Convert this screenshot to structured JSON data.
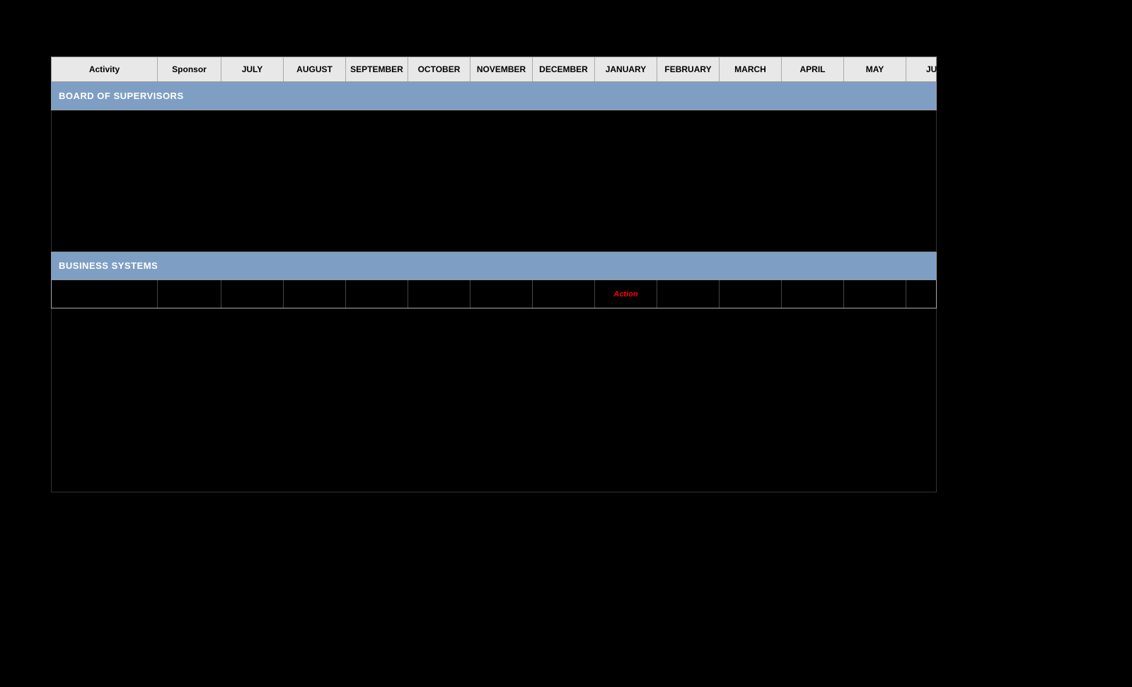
{
  "table": {
    "headers": [
      {
        "label": "Activity",
        "class": "col-activity"
      },
      {
        "label": "Sponsor",
        "class": "col-sponsor"
      },
      {
        "label": "JULY",
        "class": "col-month"
      },
      {
        "label": "AUGUST",
        "class": "col-month"
      },
      {
        "label": "SEPTEMBER",
        "class": "col-month"
      },
      {
        "label": "OCTOBER",
        "class": "col-month"
      },
      {
        "label": "NOVEMBER",
        "class": "col-month"
      },
      {
        "label": "DECEMBER",
        "class": "col-month"
      },
      {
        "label": "JANUARY",
        "class": "col-month"
      },
      {
        "label": "FEBRUARY",
        "class": "col-month"
      },
      {
        "label": "MARCH",
        "class": "col-month"
      },
      {
        "label": "APRIL",
        "class": "col-month"
      },
      {
        "label": "MAY",
        "class": "col-month"
      },
      {
        "label": "JUNE",
        "class": "col-month"
      }
    ],
    "sections": [
      {
        "title": "BOARD OF SUPERVISORS",
        "rows": [
          {
            "activity": "",
            "sponsor": "",
            "july": "",
            "august": "",
            "september": "",
            "october": "",
            "november": "",
            "december": "",
            "january": "",
            "february": "",
            "march": "",
            "april": "",
            "may": "",
            "june": ""
          },
          {
            "activity": "",
            "sponsor": "",
            "july": "",
            "august": "",
            "september": "",
            "october": "",
            "november": "",
            "december": "",
            "january": "",
            "february": "",
            "march": "",
            "april": "",
            "may": "",
            "june": ""
          },
          {
            "activity": "",
            "sponsor": "",
            "july": "",
            "august": "",
            "september": "",
            "october": "",
            "november": "",
            "december": "",
            "january": "",
            "february": "",
            "march": "",
            "april": "",
            "may": "",
            "june": ""
          },
          {
            "activity": "",
            "sponsor": "",
            "july": "",
            "august": "",
            "september": "",
            "october": "",
            "november": "",
            "december": "",
            "january": "",
            "february": "",
            "march": "",
            "april": "",
            "may": "",
            "june": ""
          },
          {
            "activity": "",
            "sponsor": "",
            "july": "",
            "august": "",
            "september": "",
            "october": "",
            "november": "",
            "december": "",
            "january": "",
            "february": "",
            "march": "",
            "april": "",
            "may": "",
            "june": ""
          }
        ]
      },
      {
        "title": "BUSINESS SYSTEMS",
        "rows": [
          {
            "activity": "",
            "sponsor": "",
            "july": "",
            "august": "",
            "september": "",
            "october": "",
            "november": "",
            "december": "",
            "january": "Action",
            "february": "",
            "march": "",
            "april": "",
            "may": "",
            "june": "",
            "action_col": "january"
          }
        ]
      }
    ]
  }
}
